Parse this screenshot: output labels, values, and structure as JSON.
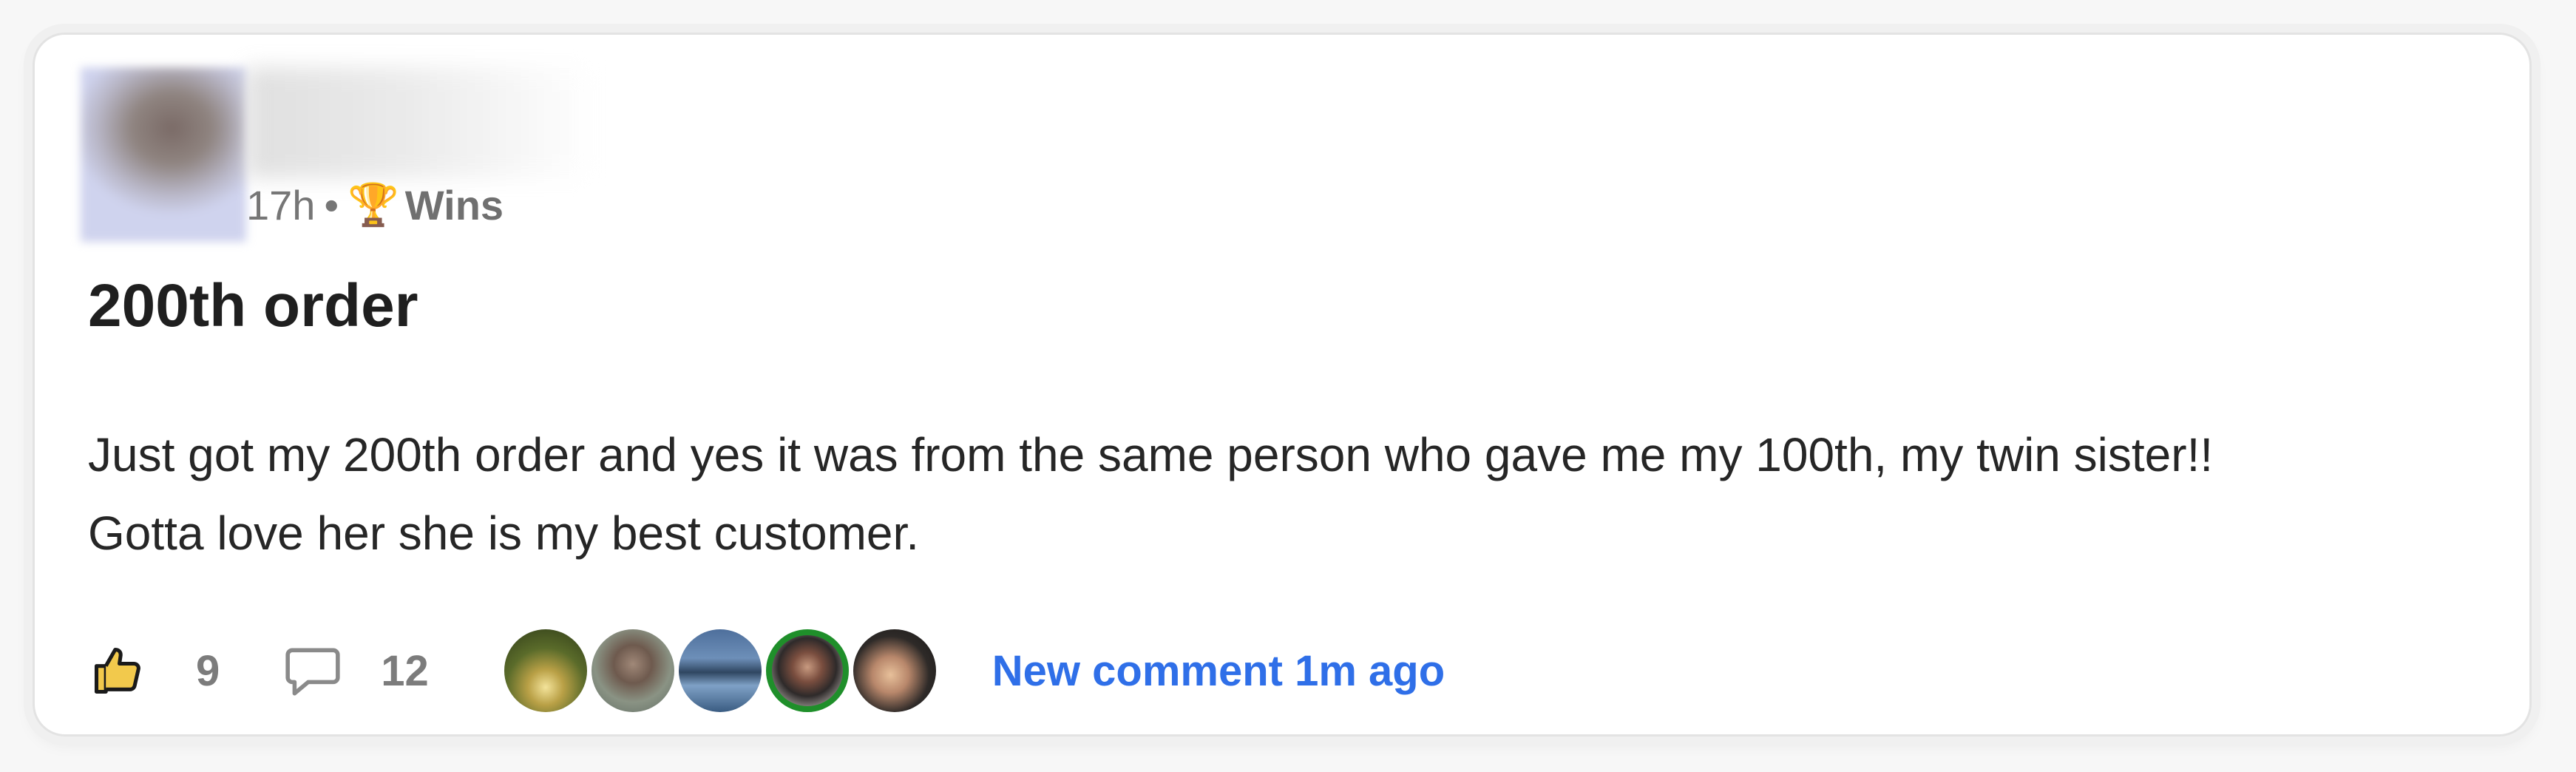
{
  "post": {
    "meta": {
      "time": "17h",
      "separator": "•",
      "category_icon": "trophy-icon",
      "category_emoji": "🏆",
      "category": "Wins"
    },
    "title": "200th order",
    "body_line1": "Just got my 200th order and yes it was from the same person who gave me my 100th, my twin sister!!",
    "body_line2": "Gotta love her she is my best customer."
  },
  "footer": {
    "like_icon": "thumbs-up-icon",
    "like_count": "9",
    "comment_icon": "comment-bubble-icon",
    "comment_count": "12",
    "commenter_avatars": [
      "avatar-1",
      "avatar-2",
      "avatar-3",
      "avatar-4",
      "avatar-5"
    ],
    "new_comment_text": "New comment 1m ago"
  },
  "colors": {
    "link": "#2f6fe8",
    "title": "#1f1f1f",
    "meta": "#767676",
    "active_avatar_ring": "#1f8f2a"
  }
}
